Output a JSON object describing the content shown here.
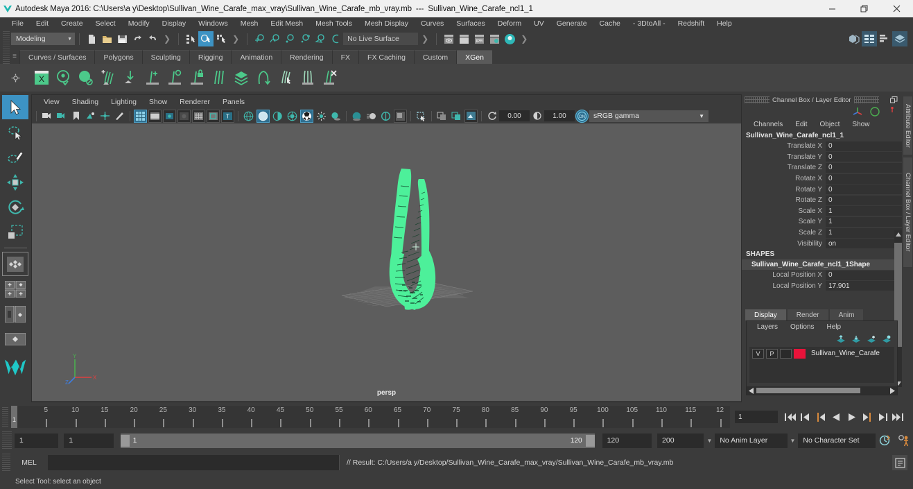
{
  "window": {
    "app_icon": "maya-app-icon",
    "title": "Autodesk Maya 2016: C:\\Users\\a y\\Desktop\\Sullivan_Wine_Carafe_max_vray\\Sullivan_Wine_Carafe_mb_vray.mb",
    "separator": "---",
    "subtitle": "Sullivan_Wine_Carafe_ncl1_1",
    "minimize": "minimize-icon",
    "maximize": "restore-icon",
    "close": "close-icon"
  },
  "menubar": {
    "items": [
      "File",
      "Edit",
      "Create",
      "Select",
      "Modify",
      "Display",
      "Windows",
      "Mesh",
      "Edit Mesh",
      "Mesh Tools",
      "Mesh Display",
      "Curves",
      "Surfaces",
      "Deform",
      "UV",
      "Generate",
      "Cache",
      "- 3DtoAll -",
      "Redshift",
      "Help"
    ]
  },
  "statusbar": {
    "menuset": "Modeling",
    "menuset_arrow": "chevron-down-icon",
    "live_surface": "No Live Surface",
    "file_icons": [
      "new-scene-icon",
      "open-scene-icon",
      "save-scene-icon",
      "undo-icon",
      "redo-icon"
    ],
    "select_mode_icons": [
      "select-by-hierarchy-icon",
      "select-by-object-icon",
      "select-by-component-icon"
    ],
    "snap_icons": [
      "snap-to-grid-icon",
      "snap-to-curve-icon",
      "snap-to-point-icon",
      "snap-to-projected-center-icon",
      "snap-to-view-plane-icon",
      "make-live-icon"
    ],
    "render_icons": [
      "render-current-frame-icon",
      "render-sequence-icon",
      "ipr-render-icon",
      "render-settings-icon",
      "hypershade-icon"
    ],
    "right_icons": [
      "show-hide-modeling-toolkit-icon",
      "show-hide-attribute-editor-icon",
      "show-hide-tool-settings-icon",
      "show-hide-channel-box-icon"
    ]
  },
  "shelf": {
    "tabs": [
      "Curves / Surfaces",
      "Polygons",
      "Sculpting",
      "Rigging",
      "Animation",
      "Rendering",
      "FX",
      "FX Caching",
      "Custom",
      "XGen"
    ],
    "active_tab": "XGen",
    "icons": [
      "xgen-window-icon",
      "xgen-preview-icon",
      "xgen-sphere-icon",
      "xgen-add-description-icon",
      "xgen-import-icon",
      "xgen-add-guide-icon",
      "xgen-circle-guide-icon",
      "xgen-lock-guide-icon",
      "xgen-comb-icon",
      "xgen-collection-icon",
      "xgen-curve-tool-icon",
      "xgen-groom-icon",
      "xgen-clump-icon",
      "xgen-delete-icon"
    ]
  },
  "viewport": {
    "menus": [
      "View",
      "Shading",
      "Lighting",
      "Show",
      "Renderer",
      "Panels"
    ],
    "toolbar_icons": [
      "select-camera-icon",
      "camera-attributes-icon",
      "bookmark-icon",
      "image-plane-icon",
      "two-pane-icon",
      "grease-pencil-icon",
      "grid-icon",
      "film-gate-icon",
      "resolution-gate-icon",
      "gate-mask-icon",
      "field-chart-icon",
      "safe-action-icon",
      "safe-title-icon",
      "wireframe-icon",
      "smooth-shade-icon",
      "shaded-wireframe-icon",
      "use-default-material-icon",
      "textured-icon",
      "use-all-lights-icon",
      "shadows-icon",
      "screen-space-ao-icon",
      "motion-blur-icon",
      "multisample-icon",
      "depth-peeling-icon",
      "xray-icon",
      "xray-joints-icon",
      "xray-active-components-icon"
    ],
    "exposure_value": "0.00",
    "gamma_value": "1.00",
    "color_management_toggle": "on",
    "color_profile": "sRGB gamma",
    "color_profile_arrow": "chevron-down-icon",
    "camera_label": "persp",
    "axis_labels": {
      "y": "Y",
      "x": "X",
      "z": "Z"
    },
    "object_color": "#4df09a",
    "background_color": "#5d5d5d"
  },
  "lefttools": {
    "items": [
      "select-tool",
      "lasso-select-tool",
      "paint-select-tool",
      "move-tool",
      "rotate-tool",
      "scale-tool",
      "last-tool-used",
      "snap-align-objects",
      "quick-layout-four-view",
      "quick-layout-outliner-persp",
      "quick-layout-hypershade-persp",
      "quick-layout-persp",
      "maya-logo"
    ],
    "selected": "select-tool"
  },
  "channelbox": {
    "panel_title": "Channel Box / Layer Editor",
    "undock_icon": "undock-icon",
    "close_icon": "close-icon",
    "manip_icons": [
      "move-manipulator-icon",
      "rotate-manipulator-icon",
      "scale-manipulator-icon"
    ],
    "menus": [
      "Channels",
      "Edit",
      "Object",
      "Show"
    ],
    "object_name": "Sullivan_Wine_Carafe_ncl1_1",
    "transform_attrs": [
      {
        "label": "Translate X",
        "value": "0"
      },
      {
        "label": "Translate Y",
        "value": "0"
      },
      {
        "label": "Translate Z",
        "value": "0"
      },
      {
        "label": "Rotate X",
        "value": "0"
      },
      {
        "label": "Rotate Y",
        "value": "0"
      },
      {
        "label": "Rotate Z",
        "value": "0"
      },
      {
        "label": "Scale X",
        "value": "1"
      },
      {
        "label": "Scale Y",
        "value": "1"
      },
      {
        "label": "Scale Z",
        "value": "1"
      },
      {
        "label": "Visibility",
        "value": "on"
      }
    ],
    "shapes_header": "SHAPES",
    "shape_name": "Sullivan_Wine_Carafe_ncl1_1Shape",
    "shape_attrs": [
      {
        "label": "Local Position X",
        "value": "0"
      },
      {
        "label": "Local Position Y",
        "value": "17.901"
      }
    ],
    "scroll_up_icon": "scroll-up-arrow-icon",
    "scroll_down_icon": "scroll-down-arrow-icon"
  },
  "layereditor": {
    "tabs": [
      "Display",
      "Render",
      "Anim"
    ],
    "active_tab": "Display",
    "menus": [
      "Layers",
      "Options",
      "Help"
    ],
    "toolbar_icons": [
      "move-layer-up-icon",
      "move-layer-down-icon",
      "new-layer-icon",
      "new-layer-from-selected-icon"
    ],
    "layers": [
      {
        "visibility": "V",
        "playback": "P",
        "shading": "",
        "color": "#e8133a",
        "name": "Sullivan_Wine_Carafe"
      }
    ],
    "scroll_left_icon": "scroll-left-arrow-icon",
    "scroll_right_icon": "scroll-right-arrow-icon"
  },
  "docktabs": {
    "items": [
      "Attribute Editor",
      "Channel Box / Layer Editor"
    ]
  },
  "timeslider": {
    "current_frame": "1",
    "ticks": [
      5,
      10,
      15,
      20,
      25,
      30,
      35,
      40,
      45,
      50,
      55,
      60,
      65,
      70,
      75,
      80,
      85,
      90,
      95,
      100,
      105,
      110,
      115
    ],
    "last_partial_tick": "12",
    "playback_field": "1",
    "playback_buttons": [
      "go-to-start-icon",
      "step-back-keyframe-icon",
      "step-back-frame-icon",
      "play-backwards-icon",
      "play-forwards-icon",
      "step-forward-frame-icon",
      "step-forward-keyframe-icon",
      "go-to-end-icon"
    ]
  },
  "rangeslider": {
    "anim_start": "1",
    "range_start": "1",
    "bar_start_label": "1",
    "bar_end_label": "120",
    "range_end": "120",
    "anim_end": "200",
    "anim_layer": "No Anim Layer",
    "anim_layer_arrow": "chevron-down-icon",
    "character_set": "No Character Set",
    "character_set_arrow": "chevron-down-icon",
    "auto_key_icon": "auto-keyframe-icon",
    "anim_prefs_icon": "animation-preferences-icon"
  },
  "commandline": {
    "language_label": "MEL",
    "input_value": "",
    "result_text": "// Result: C:/Users/a y/Desktop/Sullivan_Wine_Carafe_max_vray/Sullivan_Wine_Carafe_mb_vray.mb",
    "help_icon": "script-editor-icon"
  },
  "statusline": {
    "message": "Select Tool: select an object"
  }
}
